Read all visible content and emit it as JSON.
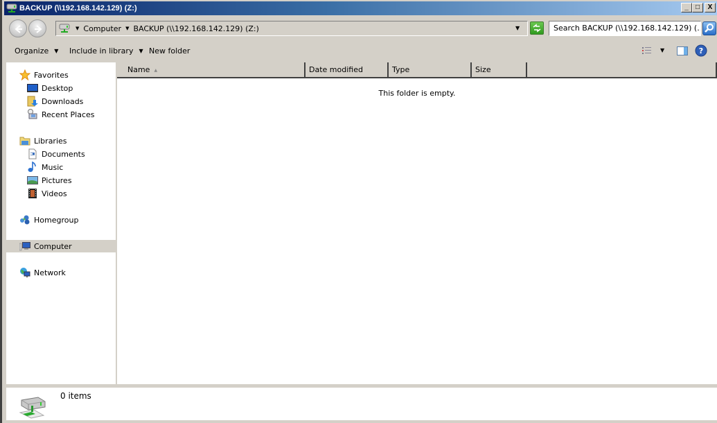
{
  "window": {
    "title": "BACKUP (\\\\192.168.142.129) (Z:)",
    "title_icon": "network-drive-icon",
    "buttons": {
      "minimize": "_",
      "maximize": "□",
      "close": "X"
    }
  },
  "navigation": {
    "back_icon": "back-arrow-icon",
    "forward_icon": "forward-arrow-icon",
    "address_icon": "network-drive-icon",
    "breadcrumbs": [
      "Computer",
      "BACKUP (\\\\192.168.142.129) (Z:)"
    ],
    "refresh_icon": "refresh-icon",
    "search_placeholder": "Search BACKUP (\\\\192.168.142.129) (...",
    "search_icon": "search-icon"
  },
  "toolbar": {
    "organize": "Organize",
    "include_in_library": "Include in library",
    "new_folder": "New folder",
    "view_icon": "view-options-icon",
    "preview_pane_icon": "preview-pane-icon",
    "help_icon": "help-icon"
  },
  "sidebar": {
    "groups": [
      {
        "label": "Favorites",
        "icon": "star-icon",
        "items": [
          {
            "label": "Desktop",
            "icon": "desktop-icon"
          },
          {
            "label": "Downloads",
            "icon": "downloads-icon"
          },
          {
            "label": "Recent Places",
            "icon": "recent-places-icon"
          }
        ]
      },
      {
        "label": "Libraries",
        "icon": "libraries-icon",
        "items": [
          {
            "label": "Documents",
            "icon": "documents-icon"
          },
          {
            "label": "Music",
            "icon": "music-icon"
          },
          {
            "label": "Pictures",
            "icon": "pictures-icon"
          },
          {
            "label": "Videos",
            "icon": "videos-icon"
          }
        ]
      },
      {
        "label": "Homegroup",
        "icon": "homegroup-icon",
        "items": []
      },
      {
        "label": "Computer",
        "icon": "computer-icon",
        "selected": true,
        "items": []
      },
      {
        "label": "Network",
        "icon": "network-icon",
        "items": []
      }
    ]
  },
  "content": {
    "columns": [
      "Name",
      "Date modified",
      "Type",
      "Size"
    ],
    "sorted_column": "Name",
    "empty_message": "This folder is empty."
  },
  "details": {
    "icon": "network-drive-icon",
    "item_count": "0 items"
  }
}
